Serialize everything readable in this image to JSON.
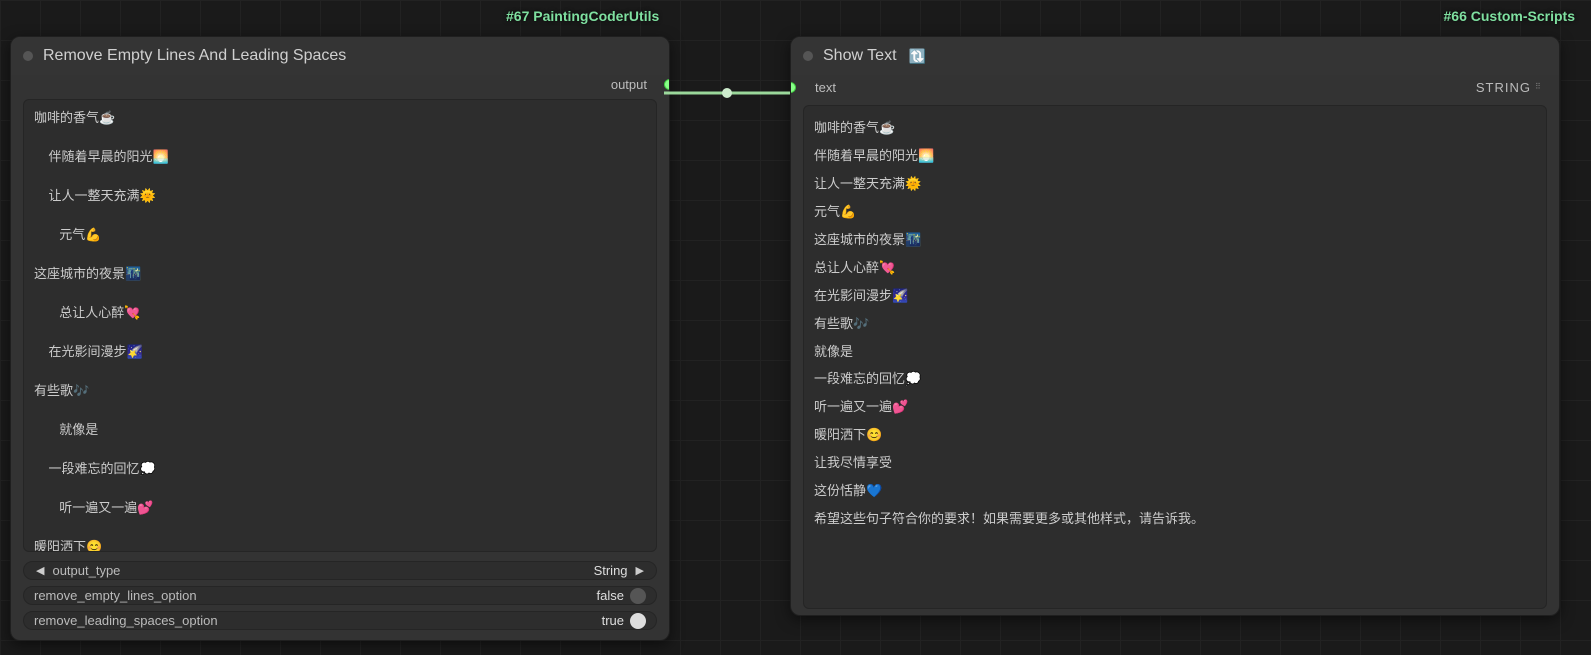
{
  "badges": {
    "left": "#67 PaintingCoderUtils",
    "right": "#66 Custom-Scripts"
  },
  "nodeLeft": {
    "title": "Remove Empty Lines And Leading Spaces",
    "output_label": "output",
    "text": "咖啡的香气☕\n\n    伴随着早晨的阳光🌅\n\n    让人一整天充满🌞\n\n       元气💪\n\n这座城市的夜景🌃\n\n       总让人心醉💘\n\n    在光影间漫步🌠\n\n有些歌🎶\n\n       就像是\n\n    一段难忘的回忆💭\n\n       听一遍又一遍💕\n\n暖阳洒下😊\n\n    让我尽情享受\n\n       这份恬静💙\n\n希望这些句子符合你的要求！如果需要更多或其他样式，请告诉我。",
    "widgets": {
      "output_type": {
        "label": "output_type",
        "value": "String"
      },
      "remove_empty": {
        "label": "remove_empty_lines_option",
        "value": "false",
        "on": false
      },
      "remove_spaces": {
        "label": "remove_leading_spaces_option",
        "value": "true",
        "on": true
      }
    }
  },
  "nodeRight": {
    "title": "Show Text",
    "input_label": "text",
    "type_label": "STRING",
    "text": "咖啡的香气☕\n伴随着早晨的阳光🌅\n让人一整天充满🌞\n元气💪\n这座城市的夜景🌃\n总让人心醉💘\n在光影间漫步🌠\n有些歌🎶\n就像是\n一段难忘的回忆💭\n听一遍又一遍💕\n暖阳洒下😊\n让我尽情享受\n这份恬静💙\n希望这些句子符合你的要求！如果需要更多或其他样式，请告诉我。"
  }
}
